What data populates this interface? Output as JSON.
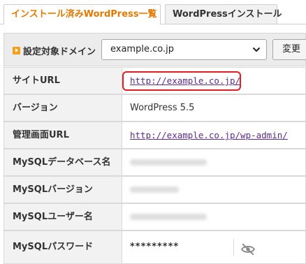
{
  "tabs": {
    "active_label": "インストール済みWordPress一覧",
    "inactive_label": "WordPressインストール"
  },
  "domain": {
    "label": "設定対象ドメイン",
    "selected": "example.co.jp",
    "change_button": "変更"
  },
  "rows": [
    {
      "label": "サイトURL",
      "value": "http://example.co.jp/"
    },
    {
      "label": "バージョン",
      "value": "WordPress 5.5"
    },
    {
      "label": "管理画面URL",
      "value": "http://example.co.jp/wp-admin/"
    },
    {
      "label": "MySQLデータベース名",
      "value": ""
    },
    {
      "label": "MySQLバージョン",
      "value": ""
    },
    {
      "label": "MySQLユーザー名",
      "value": ""
    },
    {
      "label": "MySQLパスワード",
      "value": "*********"
    }
  ],
  "colors": {
    "accent": "#e07a00",
    "highlight": "#e31b23",
    "link": "#5c2b86"
  },
  "icons": [
    "play-square-icon",
    "chevron-down-icon",
    "eye-slash-icon"
  ]
}
